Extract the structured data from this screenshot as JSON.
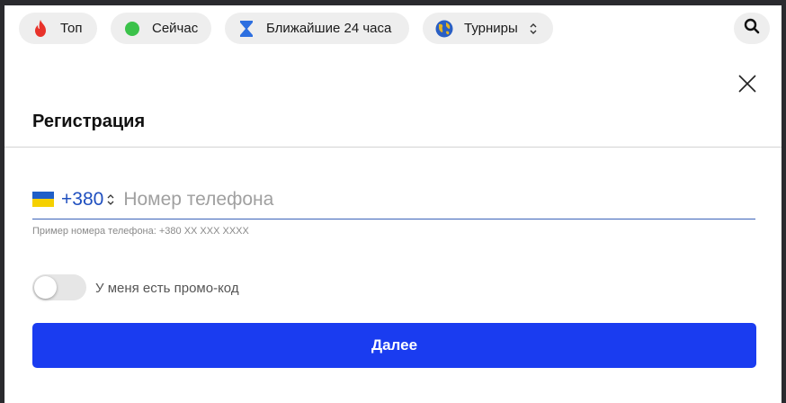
{
  "topbar": {
    "pills": [
      {
        "label": "Топ",
        "icon": "fire-icon"
      },
      {
        "label": "Сейчас",
        "icon": "live-dot-icon"
      },
      {
        "label": "Ближайшие 24 часа",
        "icon": "hourglass-icon"
      },
      {
        "label": "Турниры",
        "icon": "globe-icon"
      }
    ],
    "search_icon": "search-icon"
  },
  "dialog": {
    "title": "Регистрация",
    "phone": {
      "country_code": "+380",
      "placeholder": "Номер телефона",
      "value": "",
      "hint": "Пример номера телефона: +380 XX XXX XXXX"
    },
    "promo": {
      "label": "У меня есть промо-код",
      "enabled": false
    },
    "submit_label": "Далее"
  },
  "colors": {
    "accent": "#1a3cf0",
    "code_text": "#1f4fbf",
    "live_dot": "#3bc24a",
    "fire": "#e8322a",
    "hourglass": "#2d6fe0",
    "flag_blue": "#1f5fc8",
    "flag_yellow": "#f5d000"
  }
}
